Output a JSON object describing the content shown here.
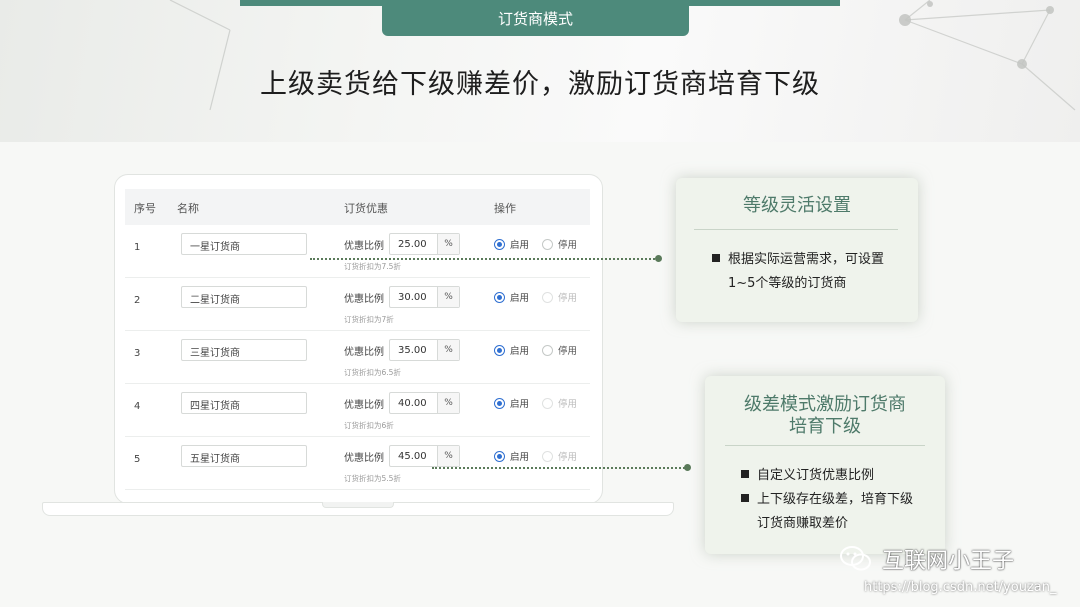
{
  "header": {
    "tab_label": "订货商模式",
    "headline": "上级卖货给下级赚差价，激励订货商培育下级"
  },
  "table": {
    "columns": [
      "序号",
      "名称",
      "订货优惠",
      "操作"
    ],
    "rows": [
      {
        "index": "1",
        "name": "一星订货商",
        "discount_label": "优惠比例",
        "discount_value": "25.00",
        "unit": "%",
        "hint": "订货折扣为7.5折",
        "enable_label": "启用",
        "disable_label": "停用",
        "disable_dimmed": false
      },
      {
        "index": "2",
        "name": "二星订货商",
        "discount_label": "优惠比例",
        "discount_value": "30.00",
        "unit": "%",
        "hint": "订货折扣为7折",
        "enable_label": "启用",
        "disable_label": "停用",
        "disable_dimmed": true
      },
      {
        "index": "3",
        "name": "三星订货商",
        "discount_label": "优惠比例",
        "discount_value": "35.00",
        "unit": "%",
        "hint": "订货折扣为6.5折",
        "enable_label": "启用",
        "disable_label": "停用",
        "disable_dimmed": false
      },
      {
        "index": "4",
        "name": "四星订货商",
        "discount_label": "优惠比例",
        "discount_value": "40.00",
        "unit": "%",
        "hint": "订货折扣为6折",
        "enable_label": "启用",
        "disable_label": "停用",
        "disable_dimmed": true
      },
      {
        "index": "5",
        "name": "五星订货商",
        "discount_label": "优惠比例",
        "discount_value": "45.00",
        "unit": "%",
        "hint": "订货折扣为5.5折",
        "enable_label": "启用",
        "disable_label": "停用",
        "disable_dimmed": true
      }
    ]
  },
  "cards": {
    "levels": {
      "title": "等级灵活设置",
      "bullet_line1": "根据实际运营需求，可设置",
      "bullet_line2": "1~5个等级的订货商"
    },
    "margin": {
      "title_line1": "级差模式激励订货商",
      "title_line2": "培育下级",
      "bullet1": "自定义订货优惠比例",
      "bullet2_line1": "上下级存在级差，培育下级",
      "bullet2_line2": "订货商赚取差价"
    }
  },
  "watermark": {
    "brand": "互联网小王子",
    "url": "https://blog.csdn.net/youzan_"
  },
  "colors": {
    "accent": "#4d8a7b",
    "card_bg": "#eff3ec",
    "radio_on": "#2f6fd1"
  }
}
